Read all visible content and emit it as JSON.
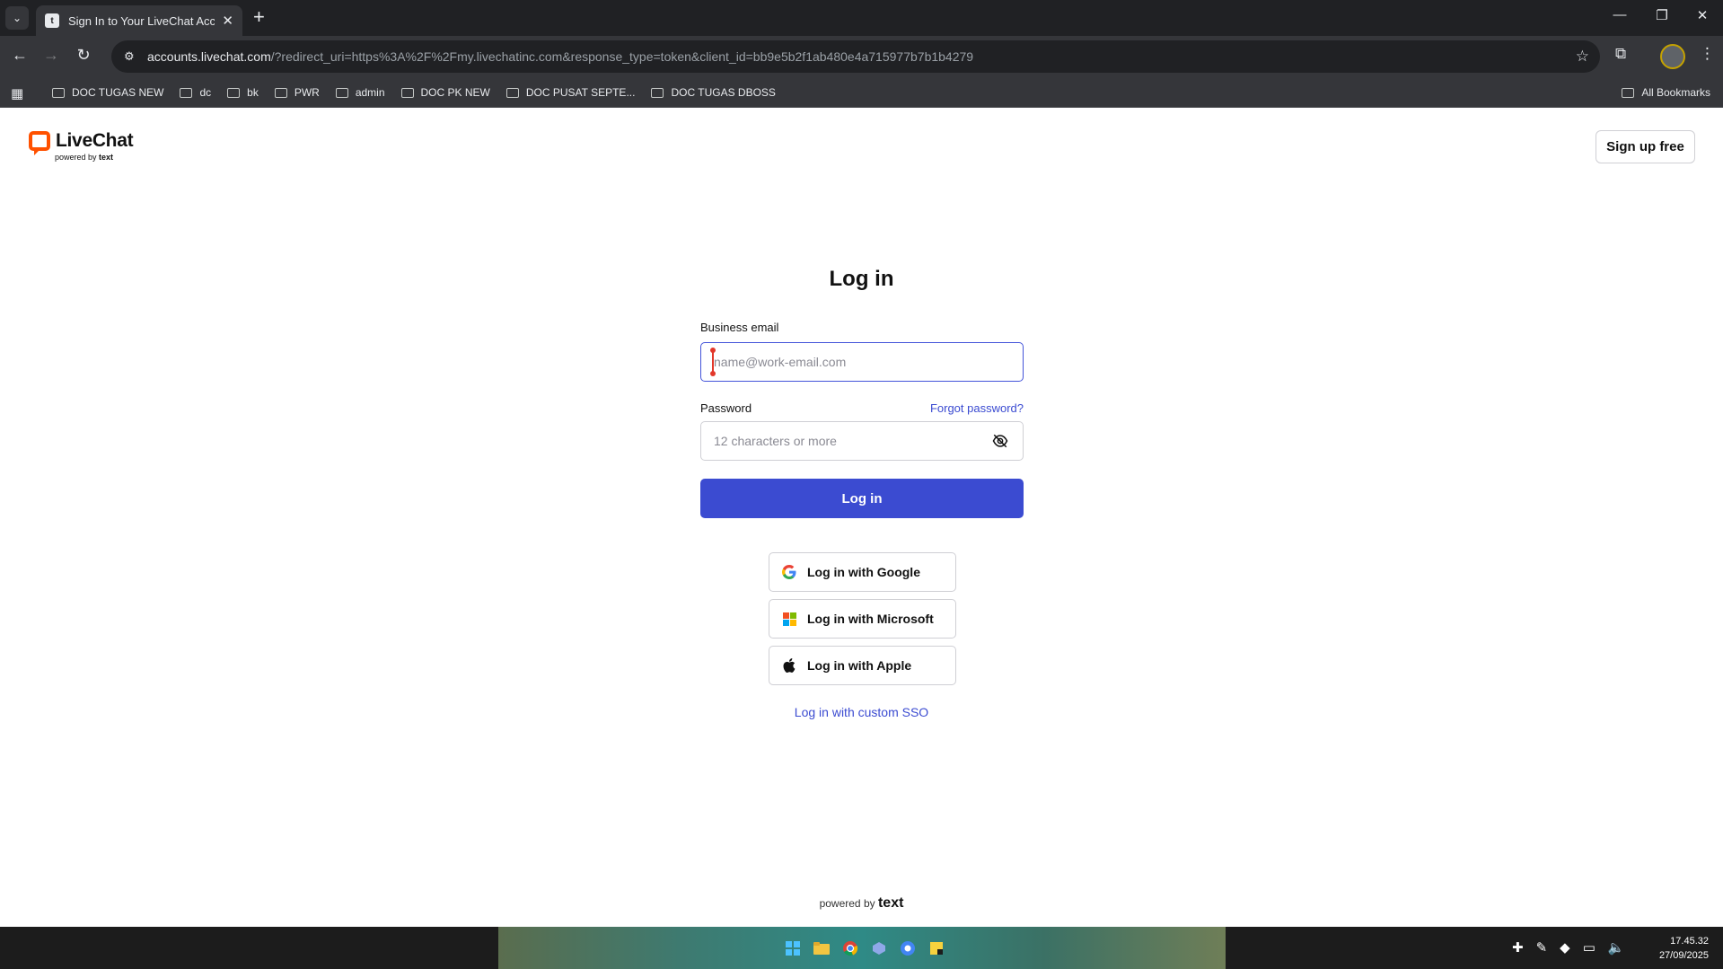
{
  "browser": {
    "tab": {
      "title": "Sign In to Your LiveChat Account"
    },
    "address": {
      "host": "accounts.livechat.com",
      "path": "/?redirect_uri=https%3A%2F%2Fmy.livechatinc.com&response_type=token&client_id=bb9e5b2f1ab480e4a715977b7b1b4279"
    },
    "bookmarks": [
      {
        "label": "DOC TUGAS NEW"
      },
      {
        "label": "dc"
      },
      {
        "label": "bk"
      },
      {
        "label": "PWR"
      },
      {
        "label": "admin"
      },
      {
        "label": "DOC PK NEW"
      },
      {
        "label": "DOC PUSAT SEPTE..."
      },
      {
        "label": "DOC TUGAS DBOSS"
      }
    ],
    "all_bookmarks": "All Bookmarks"
  },
  "header": {
    "logo_text": "LiveChat",
    "logo_powered": "powered by",
    "logo_brand": "text",
    "signup_label": "Sign up free"
  },
  "login": {
    "title": "Log in",
    "email_label": "Business email",
    "email_placeholder": "name@work-email.com",
    "email_value": "",
    "password_label": "Password",
    "forgot_label": "Forgot password?",
    "password_placeholder": "12 characters or more",
    "submit_label": "Log in"
  },
  "social": {
    "google": "Log in with Google",
    "microsoft": "Log in with Microsoft",
    "apple": "Log in with Apple",
    "sso": "Log in with custom SSO"
  },
  "footer": {
    "powered": "powered by",
    "brand": "text"
  },
  "colors": {
    "primary": "#3b4bd1",
    "brand_orange": "#ff5100",
    "microsoft": [
      "#f25022",
      "#7fba00",
      "#00a4ef",
      "#ffb900"
    ]
  },
  "taskbar": {
    "time": "17.45.32",
    "date": "27/09/2025"
  }
}
